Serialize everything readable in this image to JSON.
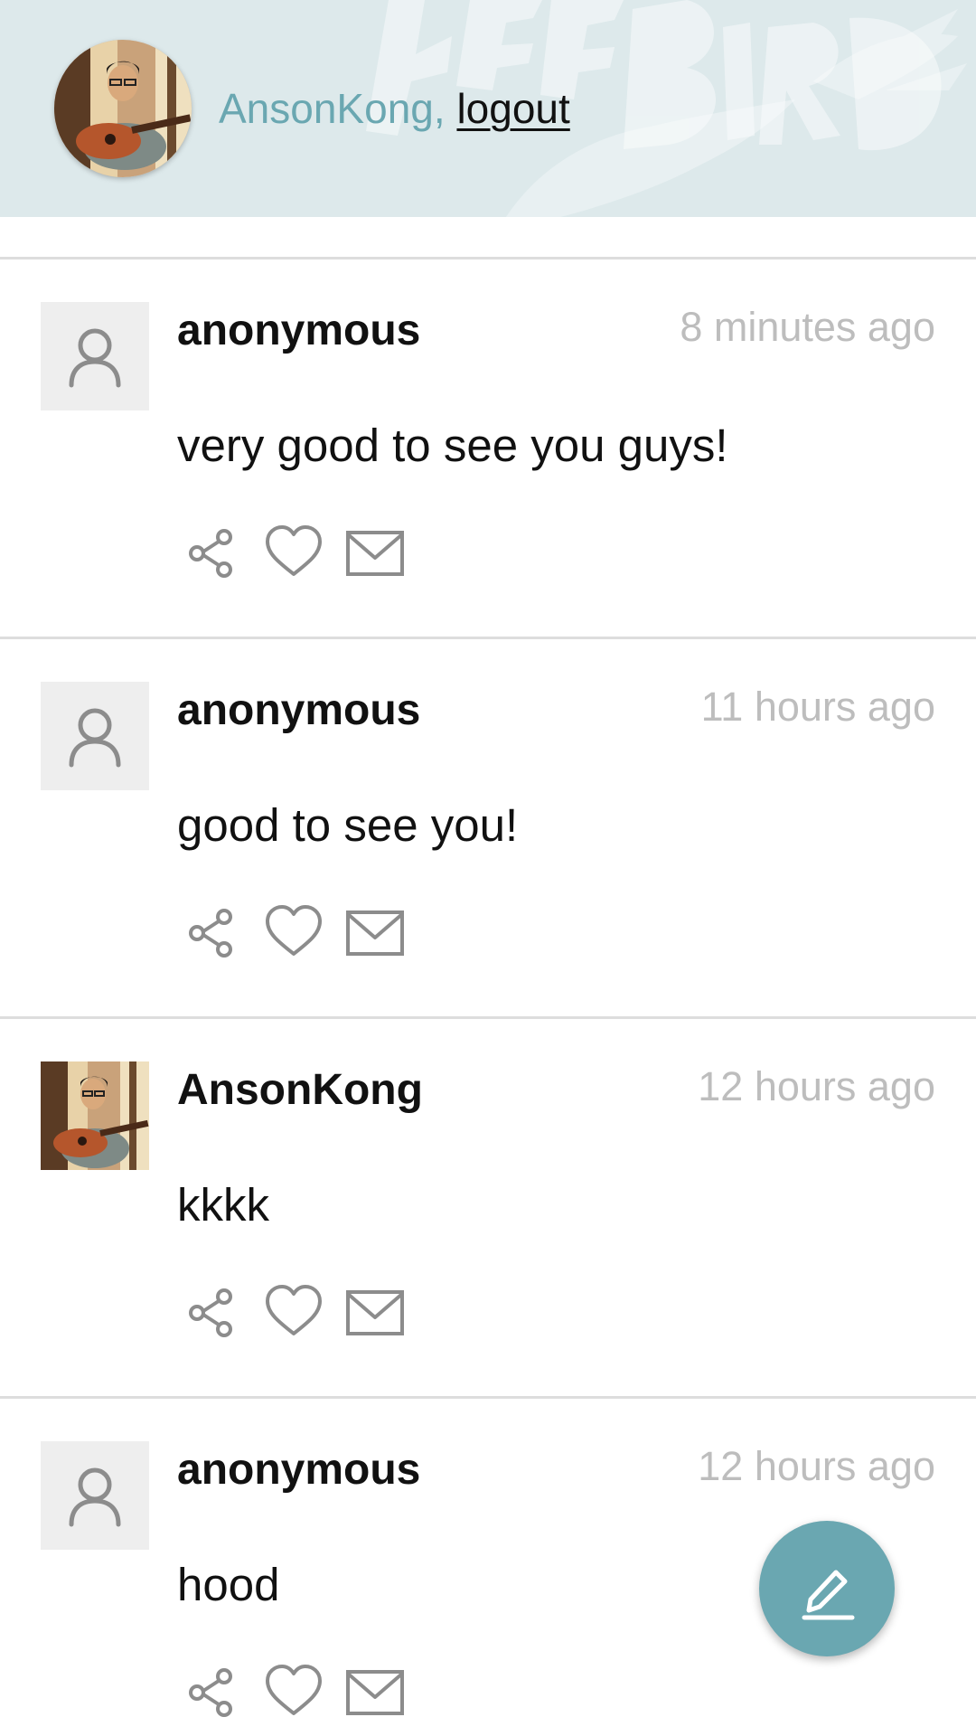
{
  "header": {
    "username": "AnsonKong,",
    "logout_label": "logout",
    "banner_text": "FREEBIRD",
    "accent_color": "#6aa7b1"
  },
  "posts": [
    {
      "author": "anonymous",
      "time": "8 minutes ago",
      "body": "very good to see you guys!",
      "avatar": "default-user-icon"
    },
    {
      "author": "anonymous",
      "time": "11 hours ago",
      "body": "good to see you!",
      "avatar": "default-user-icon"
    },
    {
      "author": "AnsonKong",
      "time": "12 hours ago",
      "body": "kkkk",
      "avatar": "user-photo"
    },
    {
      "author": "anonymous",
      "time": "12 hours ago",
      "body": "hood",
      "avatar": "default-user-icon"
    }
  ],
  "actions": [
    "share-icon",
    "heart-icon",
    "mail-icon"
  ],
  "fab": {
    "icon": "pencil-icon"
  }
}
